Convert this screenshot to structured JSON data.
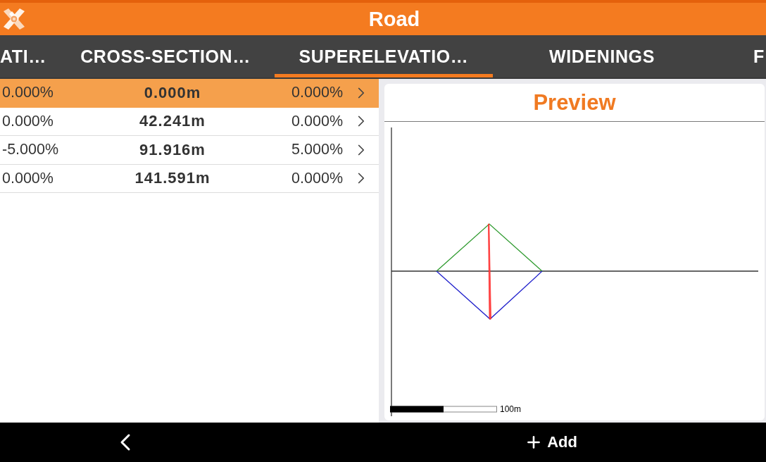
{
  "app_bar": {
    "title": "Road"
  },
  "tabs": [
    {
      "label": "ATI…",
      "selected": false
    },
    {
      "label": "CROSS-SECTION…",
      "selected": false
    },
    {
      "label": "SUPERELEVATIO…",
      "selected": true
    },
    {
      "label": "WIDENINGS",
      "selected": false
    },
    {
      "label": "F",
      "selected": false
    }
  ],
  "rows": [
    {
      "cells": [
        "0.000%",
        "0.000m",
        "0.000%"
      ],
      "selected": true
    },
    {
      "cells": [
        "0.000%",
        "42.241m",
        "0.000%"
      ],
      "selected": false
    },
    {
      "cells": [
        "-5.000%",
        "91.916m",
        "5.000%"
      ],
      "selected": false
    },
    {
      "cells": [
        "0.000%",
        "141.591m",
        "0.000%"
      ],
      "selected": false
    }
  ],
  "preview": {
    "title": "Preview",
    "scale_label": "100m"
  },
  "bottom_bar": {
    "add_label": "Add"
  }
}
